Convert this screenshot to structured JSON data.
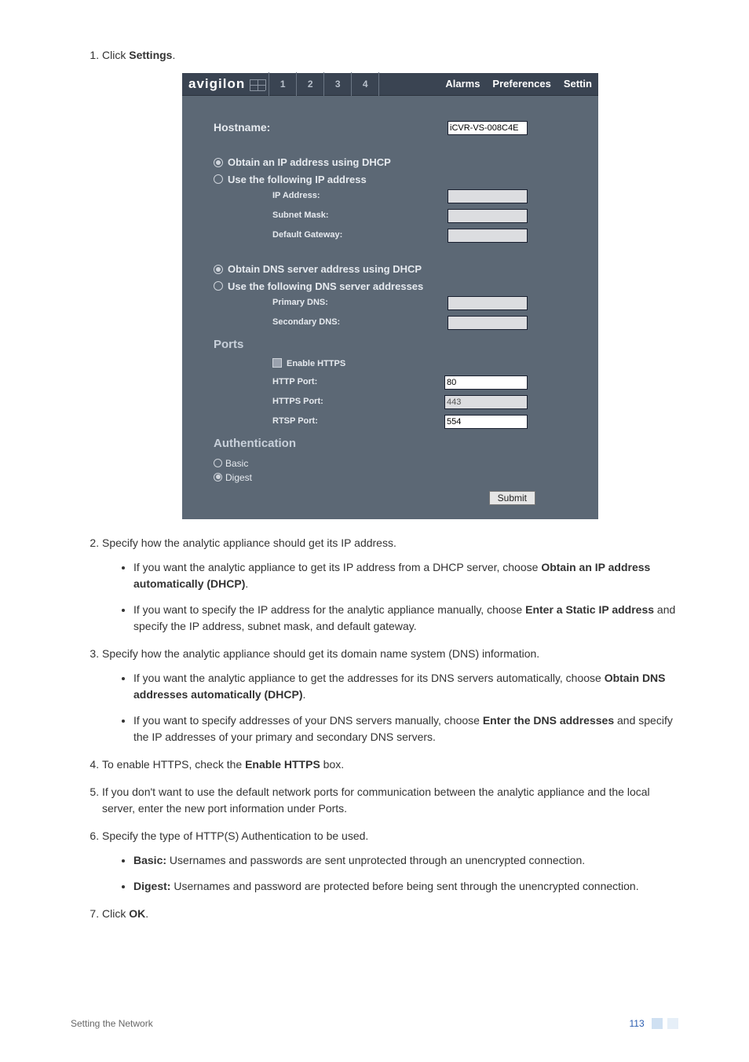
{
  "steps": {
    "s1": "Click ",
    "s1b": "Settings",
    "s1c": ".",
    "s2": "Specify how the analytic appliance should get its IP address.",
    "s2a_1": "If you want the analytic appliance to get its IP address from a DHCP server, choose ",
    "s2a_b": "Obtain an IP address automatically (DHCP)",
    "s2a_2": ".",
    "s2b_1": "If you want to specify the IP address for the analytic appliance manually, choose ",
    "s2b_b": "Enter a Static IP address",
    "s2b_2": " and specify the IP address, subnet mask, and default gateway.",
    "s3": "Specify how the analytic appliance should get its domain name system (DNS) information.",
    "s3a_1": "If you want the analytic appliance to get the addresses for its DNS servers automatically, choose ",
    "s3a_b": "Obtain DNS addresses automatically (DHCP)",
    "s3a_2": ".",
    "s3b_1": "If you want to specify addresses of your DNS servers manually, choose ",
    "s3b_b": "Enter the DNS addresses",
    "s3b_2": " and specify the IP addresses of your primary and secondary DNS servers.",
    "s4_1": "To enable HTTPS, check the ",
    "s4_b": "Enable HTTPS",
    "s4_2": " box.",
    "s5": "If you don't want to use the default network ports for communication between the analytic appliance and the local server, enter the new port information under Ports.",
    "s6": "Specify the type of HTTP(S) Authentication to be used.",
    "s6a_b": "Basic:",
    "s6a_t": " Usernames and passwords are sent unprotected through an unencrypted connection.",
    "s6b_b": "Digest:",
    "s6b_t": " Usernames and password are protected before being sent through the unencrypted connection.",
    "s7_1": "Click ",
    "s7_b": "OK",
    "s7_2": "."
  },
  "app": {
    "brand": "avigilon",
    "tabs": [
      "1",
      "2",
      "3",
      "4"
    ],
    "nav": {
      "alarms": "Alarms",
      "prefs": "Preferences",
      "settings": "Settin"
    },
    "hostname_label": "Hostname:",
    "hostname_value": "iCVR-VS-008C4E",
    "ip_opt1": "Obtain an IP address using DHCP",
    "ip_opt2": "Use the following IP address",
    "ip_addr_label": "IP Address:",
    "subnet_label": "Subnet Mask:",
    "gateway_label": "Default Gateway:",
    "dns_opt1": "Obtain DNS server address using DHCP",
    "dns_opt2": "Use the following DNS server addresses",
    "primary_dns_label": "Primary DNS:",
    "secondary_dns_label": "Secondary DNS:",
    "ports_title": "Ports",
    "enable_https_label": "Enable HTTPS",
    "http_port_label": "HTTP Port:",
    "http_port_value": "80",
    "https_port_label": "HTTPS Port:",
    "https_port_value": "443",
    "rtsp_port_label": "RTSP Port:",
    "rtsp_port_value": "554",
    "auth_title": "Authentication",
    "auth_basic": "Basic",
    "auth_digest": "Digest",
    "submit": "Submit"
  },
  "footer": {
    "section": "Setting the Network",
    "page": "113"
  }
}
